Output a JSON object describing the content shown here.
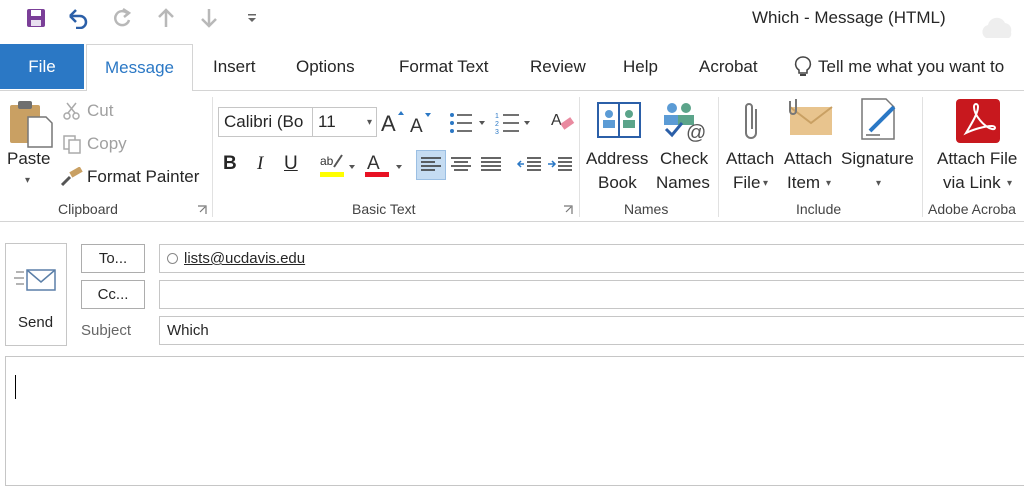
{
  "window": {
    "title": "Which  -  Message (HTML)"
  },
  "quick_access": {
    "icons": [
      "save-icon",
      "undo-icon",
      "redo-icon",
      "up-arrow-icon",
      "down-arrow-icon",
      "customize-icon"
    ]
  },
  "tabs": {
    "file": "File",
    "message": "Message",
    "insert": "Insert",
    "options": "Options",
    "format_text": "Format Text",
    "review": "Review",
    "help": "Help",
    "acrobat": "Acrobat",
    "tell_me": "Tell me what you want to"
  },
  "ribbon": {
    "clipboard": {
      "label": "Clipboard",
      "paste": "Paste",
      "cut": "Cut",
      "copy": "Copy",
      "format_painter": "Format Painter"
    },
    "basic_text": {
      "label": "Basic Text",
      "font": "Calibri (Bo",
      "size": "11"
    },
    "names": {
      "label": "Names",
      "address_book_1": "Address",
      "address_book_2": "Book",
      "check_names_1": "Check",
      "check_names_2": "Names"
    },
    "include": {
      "label": "Include",
      "attach_file_1": "Attach",
      "attach_file_2": "File",
      "attach_item_1": "Attach",
      "attach_item_2": "Item",
      "signature": "Signature"
    },
    "adobe": {
      "label": "Adobe Acroba",
      "attach_link_1": "Attach File",
      "attach_link_2": "via Link"
    }
  },
  "compose": {
    "send": "Send",
    "to_button": "To...",
    "cc_button": "Cc...",
    "to_value": "lists@ucdavis.edu",
    "cc_value": "",
    "subject_label": "Subject",
    "subject_value": "Which"
  },
  "colors": {
    "accent": "#2b78c5",
    "highlight": "#ffff00",
    "font_color": "#e81123",
    "save_purple": "#7b3f98",
    "pdf_red": "#c8181e"
  }
}
